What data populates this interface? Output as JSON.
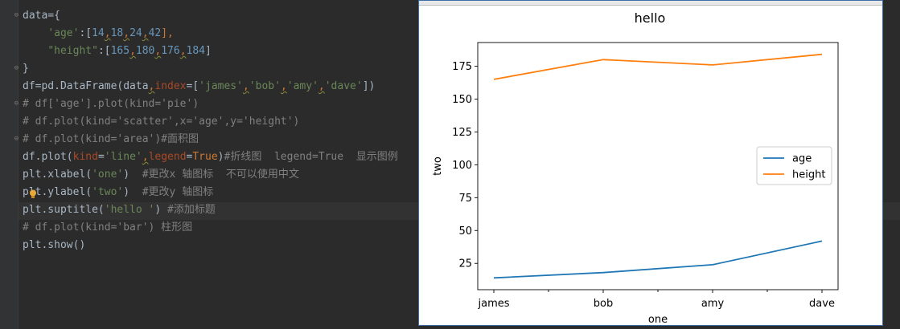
{
  "editor": {
    "lines": [
      {
        "segments": [
          {
            "t": "data={",
            "c": "plain"
          }
        ]
      },
      {
        "segments": [
          {
            "t": "    ",
            "c": "plain"
          },
          {
            "t": "'age'",
            "c": "str"
          },
          {
            "t": ":[",
            "c": "plain"
          },
          {
            "t": "14",
            "c": "num"
          },
          {
            "t": ",",
            "c": "kw"
          },
          {
            "t": "18",
            "c": "num"
          },
          {
            "t": ",",
            "c": "kw"
          },
          {
            "t": "24",
            "c": "num"
          },
          {
            "t": ",",
            "c": "kw"
          },
          {
            "t": "42",
            "c": "num"
          },
          {
            "t": "],",
            "c": "kw"
          }
        ]
      },
      {
        "segments": [
          {
            "t": "    ",
            "c": "plain"
          },
          {
            "t": "\"height\"",
            "c": "str"
          },
          {
            "t": ":[",
            "c": "plain"
          },
          {
            "t": "165",
            "c": "num"
          },
          {
            "t": ",",
            "c": "kw"
          },
          {
            "t": "180",
            "c": "num"
          },
          {
            "t": ",",
            "c": "kw"
          },
          {
            "t": "176",
            "c": "num"
          },
          {
            "t": ",",
            "c": "kw"
          },
          {
            "t": "184",
            "c": "num"
          },
          {
            "t": "]",
            "c": "plain"
          }
        ]
      },
      {
        "segments": [
          {
            "t": "}",
            "c": "plain"
          }
        ]
      },
      {
        "segments": [
          {
            "t": "df=pd.DataFrame(data",
            "c": "plain"
          },
          {
            "t": ",",
            "c": "kw"
          },
          {
            "t": "index",
            "c": "param"
          },
          {
            "t": "=[",
            "c": "plain"
          },
          {
            "t": "'james'",
            "c": "str"
          },
          {
            "t": ",",
            "c": "kw"
          },
          {
            "t": "'bob'",
            "c": "str"
          },
          {
            "t": ",",
            "c": "kw"
          },
          {
            "t": "'amy'",
            "c": "str"
          },
          {
            "t": ",",
            "c": "kw"
          },
          {
            "t": "'dave'",
            "c": "str"
          },
          {
            "t": "])",
            "c": "plain"
          }
        ]
      },
      {
        "segments": [
          {
            "t": "# df['age'].plot(kind='pie')",
            "c": "com"
          }
        ]
      },
      {
        "segments": [
          {
            "t": "# df.plot(kind='scatter',x='age',y='height')",
            "c": "com"
          }
        ]
      },
      {
        "segments": [
          {
            "t": "# df.plot(kind='area')#面积图",
            "c": "com"
          }
        ]
      },
      {
        "segments": [
          {
            "t": "df.plot(",
            "c": "plain"
          },
          {
            "t": "kind",
            "c": "param"
          },
          {
            "t": "=",
            "c": "plain"
          },
          {
            "t": "'line'",
            "c": "str"
          },
          {
            "t": ",",
            "c": "kw"
          },
          {
            "t": "legend",
            "c": "param"
          },
          {
            "t": "=",
            "c": "plain"
          },
          {
            "t": "True",
            "c": "const"
          },
          {
            "t": ")",
            "c": "plain"
          },
          {
            "t": "#折线图  legend=True  显示图例",
            "c": "com"
          }
        ]
      },
      {
        "segments": [
          {
            "t": "plt.xlabel(",
            "c": "plain"
          },
          {
            "t": "'one'",
            "c": "str"
          },
          {
            "t": ")  ",
            "c": "plain"
          },
          {
            "t": "#更改x 轴图标  不可以使用中文",
            "c": "com"
          }
        ]
      },
      {
        "segments": [
          {
            "t": "plt.ylabel(",
            "c": "plain"
          },
          {
            "t": "'two'",
            "c": "str"
          },
          {
            "t": ")  ",
            "c": "plain"
          },
          {
            "t": "#更改y 轴图标",
            "c": "com"
          }
        ]
      },
      {
        "segments": [
          {
            "t": "plt.suptitle(",
            "c": "plain"
          },
          {
            "t": "'hello '",
            "c": "str"
          },
          {
            "t": ") ",
            "c": "plain"
          },
          {
            "t": "#添加标题",
            "c": "com"
          }
        ]
      },
      {
        "segments": [
          {
            "t": "# df.plot(kind='bar') 柱形图",
            "c": "com"
          }
        ]
      },
      {
        "segments": [
          {
            "t": "plt.show()",
            "c": "plain"
          }
        ]
      }
    ]
  },
  "colors": {
    "editor_bg": "#2b2b2b",
    "series_age": "#1f77b4",
    "series_height": "#ff7f0e"
  },
  "chart_data": {
    "type": "line",
    "title": "hello",
    "xlabel": "one",
    "ylabel": "two",
    "categories": [
      "james",
      "bob",
      "amy",
      "dave"
    ],
    "series": [
      {
        "name": "age",
        "values": [
          14,
          18,
          24,
          42
        ]
      },
      {
        "name": "height",
        "values": [
          165,
          180,
          176,
          184
        ]
      }
    ],
    "ylim": [
      5,
      193
    ],
    "yticks": [
      25,
      50,
      75,
      100,
      125,
      150,
      175
    ],
    "grid": false,
    "legend": "center-right"
  }
}
